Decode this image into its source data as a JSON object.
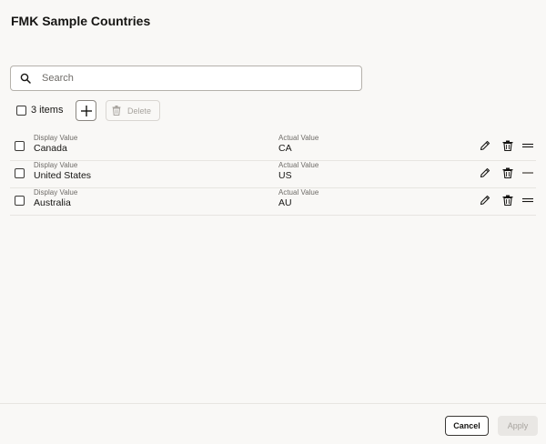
{
  "dialog": {
    "title": "FMK Sample Countries"
  },
  "search": {
    "placeholder": "Search",
    "value": ""
  },
  "toolbar": {
    "items_label": "3 items",
    "add_icon": "plus-icon",
    "delete_label": "Delete",
    "delete_enabled": false
  },
  "list": {
    "display_label": "Display Value",
    "actual_label": "Actual Value",
    "rows": [
      {
        "display": "Canada",
        "actual": "CA"
      },
      {
        "display": "United States",
        "actual": "US"
      },
      {
        "display": "Australia",
        "actual": "AU"
      }
    ]
  },
  "footer": {
    "cancel_label": "Cancel",
    "apply_label": "Apply",
    "apply_enabled": false
  },
  "colors": {
    "background": "#f9f8f6",
    "border": "#b5b1ab",
    "text": "#161513",
    "muted": "#6f6c68",
    "disabled": "#a8a49f"
  }
}
